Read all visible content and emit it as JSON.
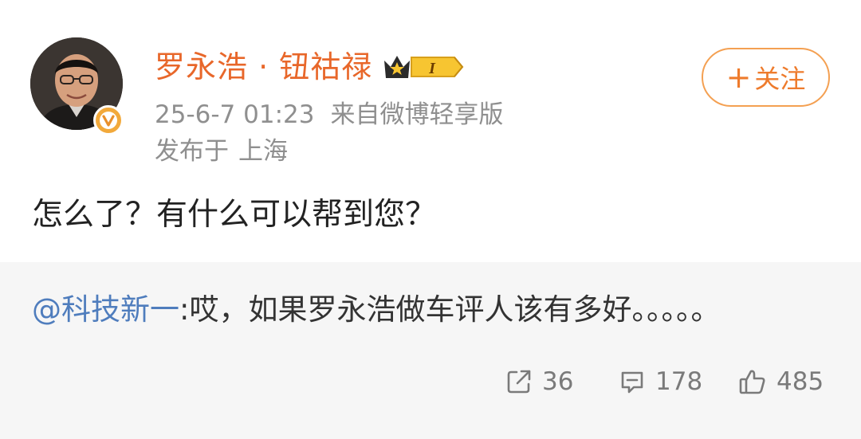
{
  "post": {
    "author": {
      "name": "罗永浩 · 钮祜禄",
      "vip_level": "I"
    },
    "meta": {
      "timestamp": "25-6-7 01:23",
      "source": "来自微博轻享版"
    },
    "location": {
      "prefix": "发布于",
      "place": "上海"
    },
    "follow_button": {
      "plus": "+",
      "label": "关注"
    },
    "text": "怎么了？有什么可以帮到您？"
  },
  "repost": {
    "mention": "@科技新一",
    "separator": ":",
    "text": "哎，如果罗永浩做车评人该有多好。。。。。"
  },
  "actions": {
    "repost_count": "36",
    "comment_count": "178",
    "like_count": "485"
  },
  "colors": {
    "name": "#e8672a",
    "follow_border": "#f4a052",
    "mention": "#4f7dbd",
    "meta": "#8f8f8f",
    "quote_bg": "#f6f6f6",
    "verified_badge": "#f2a93b"
  },
  "icons": {
    "avatar": "avatar-photo",
    "verified": "verified-v-icon",
    "vip": "vip-crown-badge-icon",
    "repost": "repost-icon",
    "comment": "comment-icon",
    "like": "thumbs-up-icon"
  }
}
